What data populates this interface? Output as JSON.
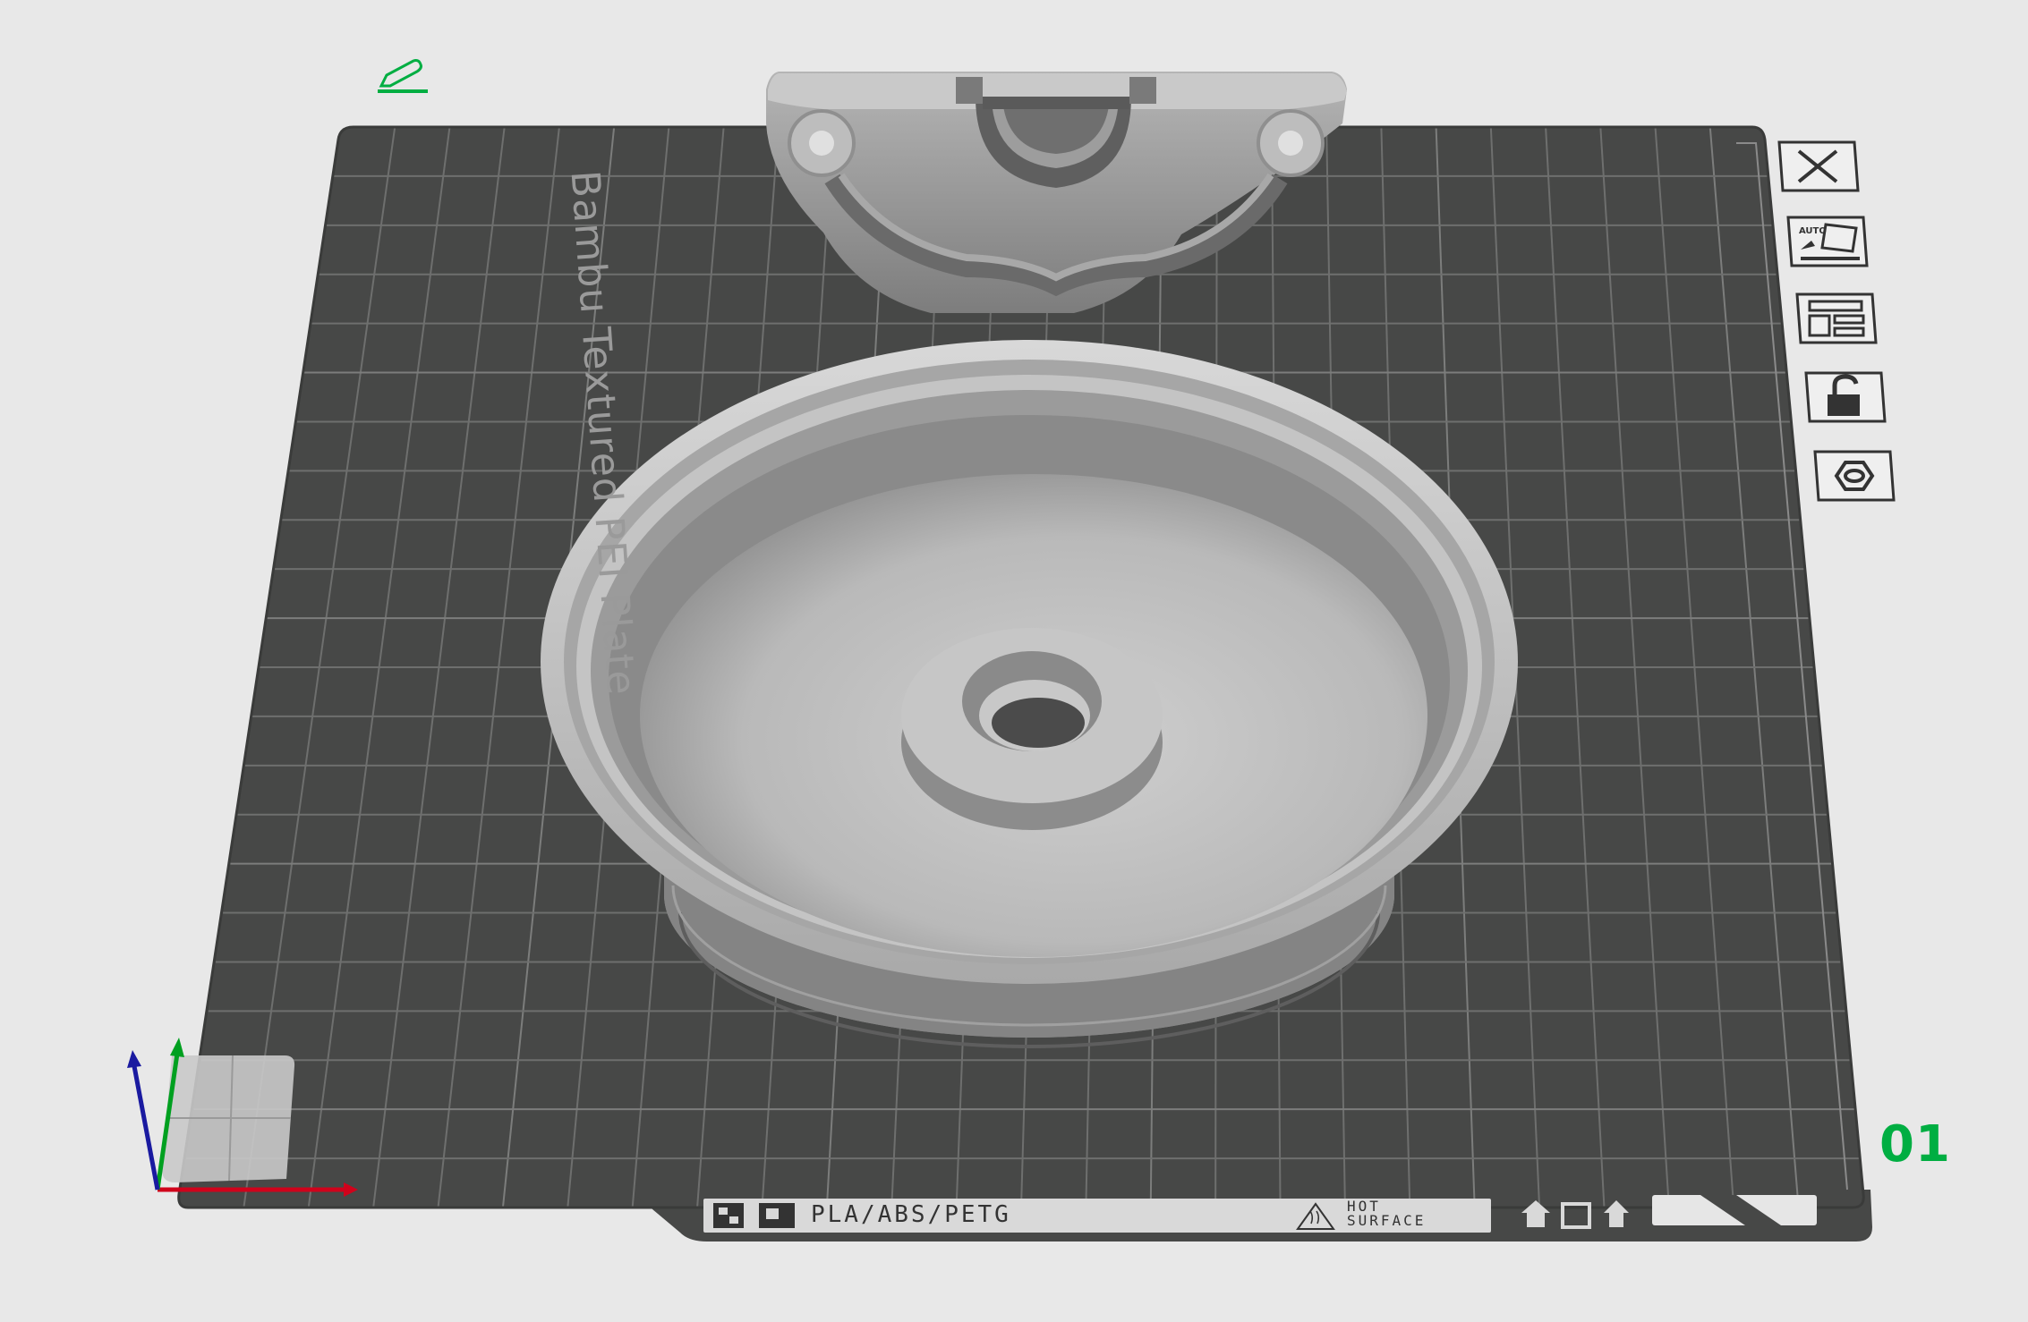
{
  "plate": {
    "name": "Bambu Textured PEI Plate",
    "number": "01",
    "filament_label": "PLA/ABS/PETG",
    "hot_line1": "HOT",
    "hot_line2": "SURFACE"
  },
  "toolbar": {
    "items": [
      {
        "name": "close",
        "icon": "close-icon"
      },
      {
        "name": "auto-orient",
        "icon": "auto-orient-icon",
        "text": "AUTO"
      },
      {
        "name": "arrange",
        "icon": "arrange-icon"
      },
      {
        "name": "lock",
        "icon": "unlock-icon"
      },
      {
        "name": "plate-settings",
        "icon": "hexagon-nut-icon"
      }
    ]
  },
  "colors": {
    "background": "#e8e8e8",
    "plate": "#474847",
    "grid": "#6e6f6e",
    "model": "#bdbdbd",
    "accent": "#00ae42",
    "axis_x": "#d0021b",
    "axis_y": "#00a020",
    "axis_z": "#1a1aa0"
  }
}
